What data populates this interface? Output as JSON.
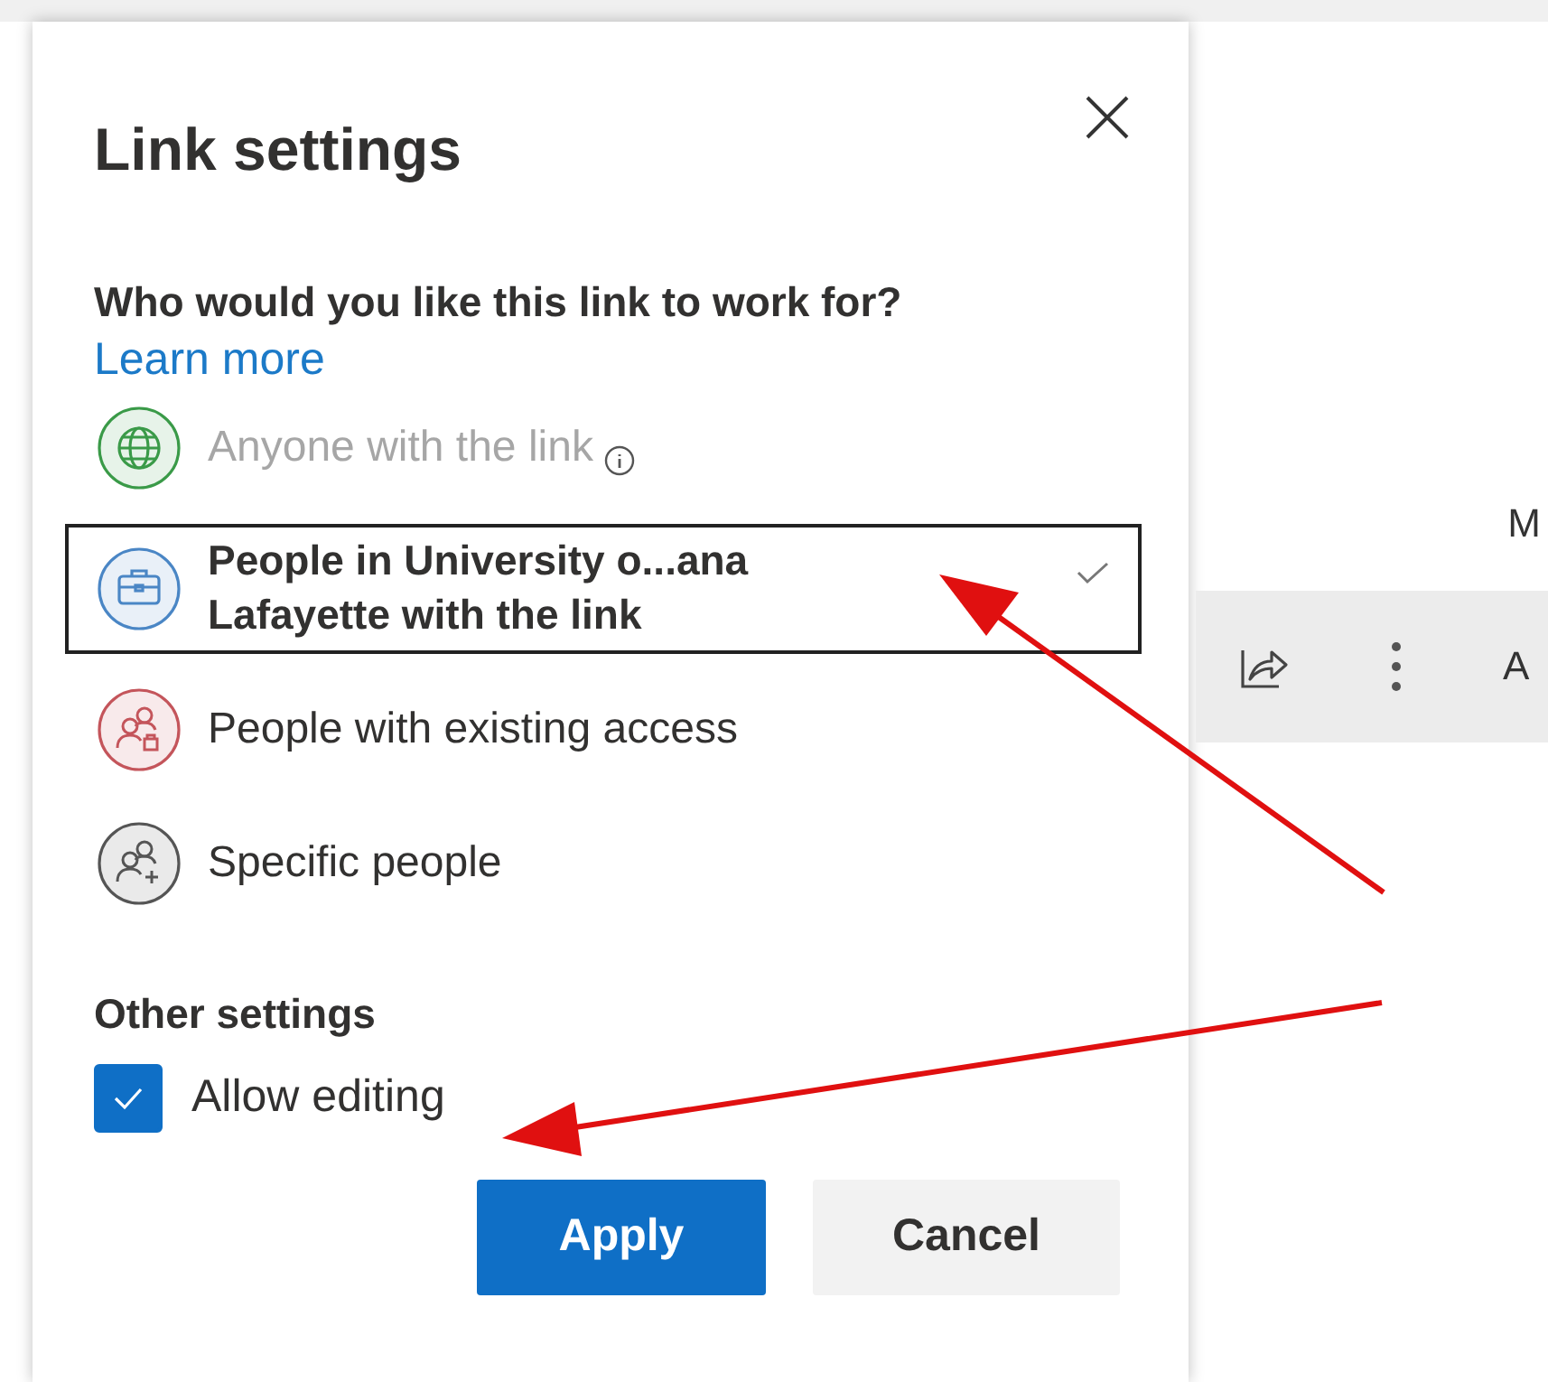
{
  "dialog": {
    "title": "Link settings",
    "question": "Who would you like this link to work for?",
    "learn_more": "Learn more",
    "options": [
      {
        "label": "Anyone with the link",
        "kind": "globe",
        "color": "#3a9a48",
        "disabled": true,
        "info": true,
        "selected": false
      },
      {
        "label": "People in University o...ana Lafayette with the link",
        "kind": "briefcase",
        "color": "#4a86c5",
        "disabled": false,
        "info": false,
        "selected": true
      },
      {
        "label": "People with existing access",
        "kind": "people-lock",
        "color": "#c4555b",
        "disabled": false,
        "info": false,
        "selected": false
      },
      {
        "label": "Specific people",
        "kind": "people-add",
        "color": "#555555",
        "disabled": false,
        "info": false,
        "selected": false
      }
    ],
    "other_settings": {
      "heading": "Other settings",
      "checkbox": {
        "label": "Allow editing",
        "checked": true
      }
    },
    "buttons": [
      {
        "label": "Apply",
        "kind": "primary"
      },
      {
        "label": "Cancel",
        "kind": "secondary"
      }
    ]
  },
  "background": {
    "header_text": "M",
    "row_text": "A"
  }
}
